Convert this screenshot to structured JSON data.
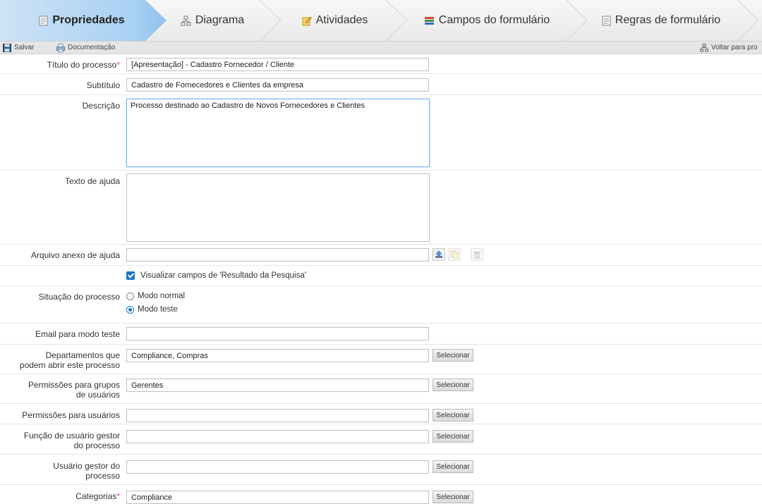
{
  "tabs": [
    {
      "label": "Propriedades",
      "icon": "document-icon",
      "active": true
    },
    {
      "label": "Diagrama",
      "icon": "diagram-icon",
      "active": false
    },
    {
      "label": "Atividades",
      "icon": "activities-icon",
      "active": false
    },
    {
      "label": "Campos do formulário",
      "icon": "form-fields-icon",
      "active": false
    },
    {
      "label": "Regras de formulário",
      "icon": "rules-icon",
      "active": false
    }
  ],
  "toolbar": {
    "save_label": "Salvar",
    "doc_label": "Documentação",
    "back_label": "Voltar para pro"
  },
  "form": {
    "title_label": "Título do processo",
    "title_value": "[Apresentação] - Cadastro Fornecedor / Cliente",
    "subtitle_label": "Subtítulo",
    "subtitle_value": "Cadastro de Fornecedores e Clientes da empresa",
    "description_label": "Descrição",
    "description_value": "Processo destinado ao Cadastro de Novos Fornecedores e Clientes",
    "help_label": "Texto de ajuda",
    "help_value": "",
    "attachment_label": "Arquivo anexo de ajuda",
    "attachment_value": "",
    "search_results_label": "Visualizar campos de 'Resultado da Pesquisa'",
    "status_label": "Situação do processo",
    "mode_normal": "Modo normal",
    "mode_test": "Modo teste",
    "test_email_label": "Email para modo teste",
    "test_email_value": "",
    "departments_label_1": "Departamentos que",
    "departments_label_2": "podem abrir este processo",
    "departments_value": "Compliance, Compras",
    "group_perm_label_1": "Permissões para grupos",
    "group_perm_label_2": "de usuários",
    "group_perm_value": "Gerentes",
    "user_perm_label": "Permissões para usuários",
    "user_perm_value": "",
    "manager_role_label_1": "Função de usuário gestor",
    "manager_role_label_2": "do processo",
    "manager_role_value": "",
    "manager_user_label_1": "Usuário gestor do",
    "manager_user_label_2": "processo",
    "manager_user_value": "",
    "categories_label": "Categorias",
    "categories_value": "Compliance",
    "select_label": "Selecionar",
    "required_mark": "*"
  },
  "colors": {
    "accent": "#1e74c6",
    "active_tab": "#9dc8ef",
    "required": "#d9534f"
  }
}
